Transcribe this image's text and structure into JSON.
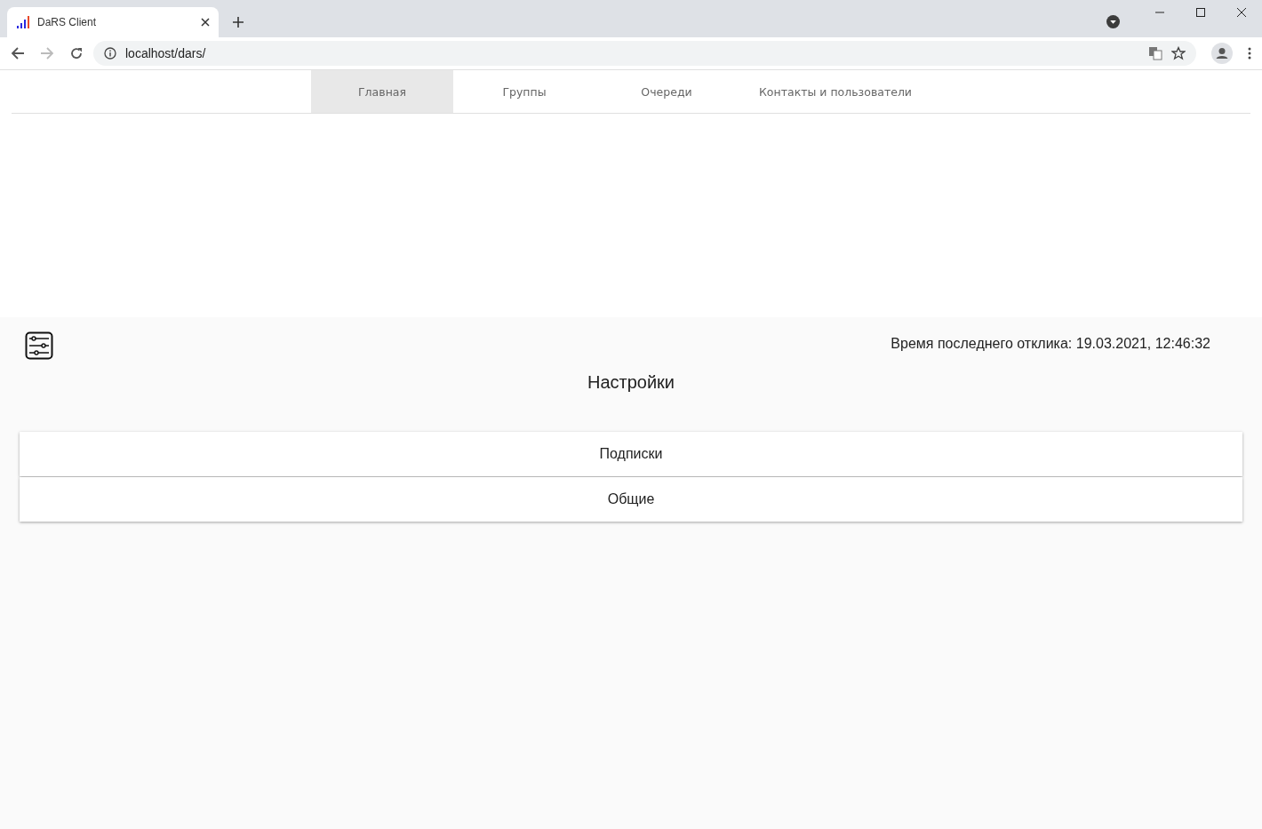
{
  "browser": {
    "tab_title": "DaRS Client",
    "url": "localhost/dars/"
  },
  "nav_tabs": [
    {
      "label": "Главная",
      "selected": true
    },
    {
      "label": "Группы",
      "selected": false
    },
    {
      "label": "Очереди",
      "selected": false
    },
    {
      "label": "Контакты и пользователи",
      "selected": false
    }
  ],
  "settings": {
    "last_response": "Время последнего отклика: 19.03.2021, 12:46:32",
    "title": "Настройки",
    "sections": [
      {
        "label": "Подписки"
      },
      {
        "label": "Общие"
      }
    ]
  }
}
